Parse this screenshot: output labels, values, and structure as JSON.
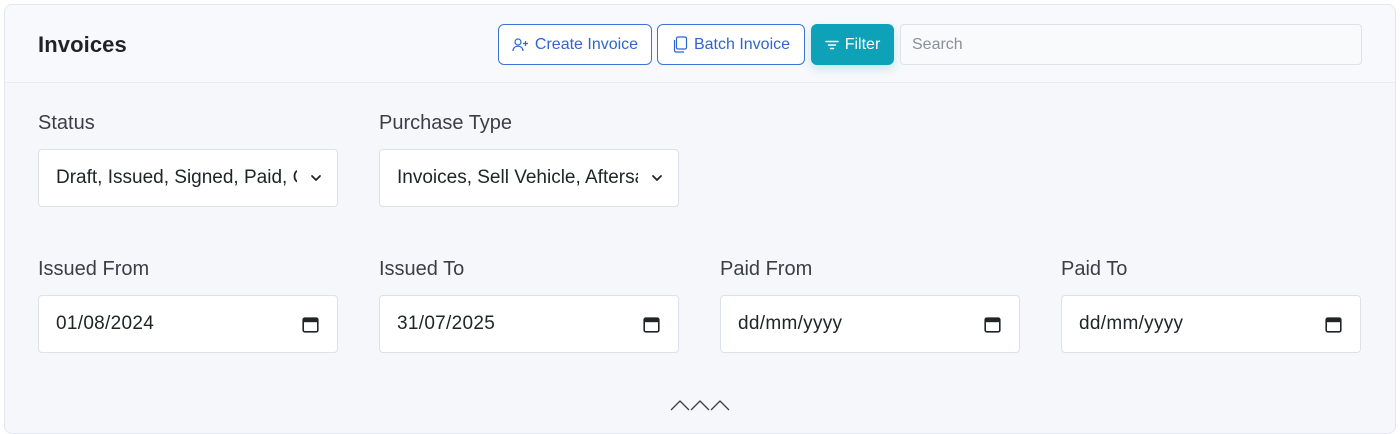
{
  "header": {
    "title": "Invoices",
    "create_invoice_label": "Create Invoice",
    "batch_invoice_label": "Batch Invoice",
    "filter_label": "Filter",
    "search_placeholder": "Search",
    "search_value": ""
  },
  "filters": {
    "status": {
      "label": "Status",
      "value": "Draft, Issued, Signed, Paid, Cancelled"
    },
    "purchase_type": {
      "label": "Purchase Type",
      "value": "Invoices, Sell Vehicle, Aftersales"
    },
    "issued_from": {
      "label": "Issued From",
      "value": "01/08/2024"
    },
    "issued_to": {
      "label": "Issued To",
      "value": "31/07/2025"
    },
    "paid_from": {
      "label": "Paid From",
      "value": "dd/mm/yyyy"
    },
    "paid_to": {
      "label": "Paid To",
      "value": "dd/mm/yyyy"
    }
  },
  "colors": {
    "primary_outline": "#2f66cc",
    "filter_accent": "#0ea2b8",
    "card_background": "#f6f7fb"
  },
  "icons": {
    "create_invoice": "user-plus-icon",
    "batch_invoice": "copy-icon",
    "filter": "filter-lines-icon",
    "dropdown": "chevron-down-icon",
    "date": "calendar-icon",
    "collapse": "chevron-up-triple-icon"
  }
}
